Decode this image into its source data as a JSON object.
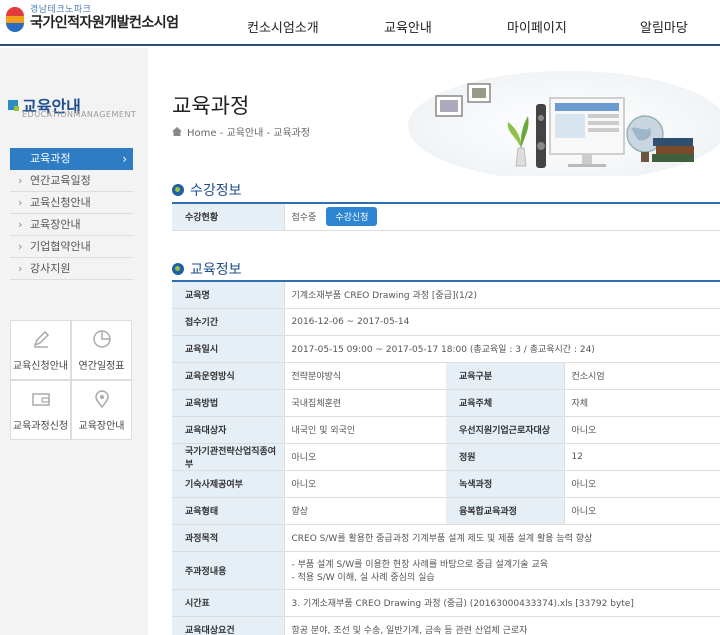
{
  "header": {
    "logo_sub": "경남테크노파크",
    "logo_main": "국가인적자원개발컨소시엄",
    "nav": [
      "컨소시엄소개",
      "교육안내",
      "마이페이지",
      "알림마당"
    ]
  },
  "sidebar": {
    "title": "교육안내",
    "subtitle": "EDUCATIONMANAGEMENT",
    "active_item": "교육과정",
    "items": [
      "연간교육일정",
      "교육신청안내",
      "교육장안내",
      "기업협약안내",
      "강사지원"
    ],
    "quick_links": [
      {
        "label": "교육신청안내",
        "icon": "pencil-icon"
      },
      {
        "label": "연간일정표",
        "icon": "pie-chart-icon"
      },
      {
        "label": "교육과정신청",
        "icon": "wallet-icon"
      },
      {
        "label": "교육장안내",
        "icon": "map-pin-icon"
      }
    ]
  },
  "main": {
    "title": "교육과정",
    "breadcrumb": "Home - 교육안내 - 교육과정",
    "section1_title": "수강정보",
    "enrollment": {
      "label": "수강현황",
      "status": "접수중",
      "button": "수강신청"
    },
    "section2_title": "교육정보",
    "info": {
      "course_name_label": "교육명",
      "course_name": "기계소재부품 CREO Drawing 과정 [중급](1/2)",
      "reception_label": "접수기간",
      "reception": "2016-12-06 ~ 2017-05-14",
      "schedule_label": "교육일시",
      "schedule": "2017-05-15 09:00 ~ 2017-05-17 18:00 (총교육일 : 3 / 총교육시간 : 24)",
      "operation_label": "교육운영방식",
      "operation": "전략분야방식",
      "category_label": "교육구분",
      "category": "컨소시엄",
      "method_label": "교육방법",
      "method": "국내집체훈련",
      "host_label": "교육주체",
      "host": "자체",
      "target_label": "교육대상자",
      "target": "내국인 및 외국인",
      "priority_label": "우선지원기업근로자대상",
      "priority": "아니오",
      "national_label": "국가기관전략산업직종여부",
      "national": "아니오",
      "capacity_label": "정원",
      "capacity": "12",
      "offline_label": "기숙사제공여부",
      "offline": "아니오",
      "green_label": "녹색과정",
      "green": "아니오",
      "form_label": "교육형태",
      "form": "향상",
      "fusion_label": "융복합교육과정",
      "fusion": "아니오",
      "purpose_label": "과정목적",
      "purpose": "CREO S/W를 활용한 중급과정 기계부품 설계 제도 및 제품 설계 활용 능력 향상",
      "content_label": "주과정내용",
      "content_1": "- 부품 설계 S/W를 이용한 현장 사례를 바탕으로 중급 설계기술 교육",
      "content_2": "- 적용 S/W 이해, 실 사례 중심의 실습",
      "timetable_label": "시간표",
      "timetable": "3. 기계소재부품 CREO Drawing 과정 (중급) (20163000433374).xls [33792 byte]",
      "audience_label": "교육대상요건",
      "audience": "항공 분야, 조선 및 수송, 일반기계, 금속 등 관련 산업체 근로자"
    }
  },
  "colors": {
    "brand": "#1f4f8c",
    "accent": "#2e7cc4",
    "header_cell": "#e6eef6"
  }
}
